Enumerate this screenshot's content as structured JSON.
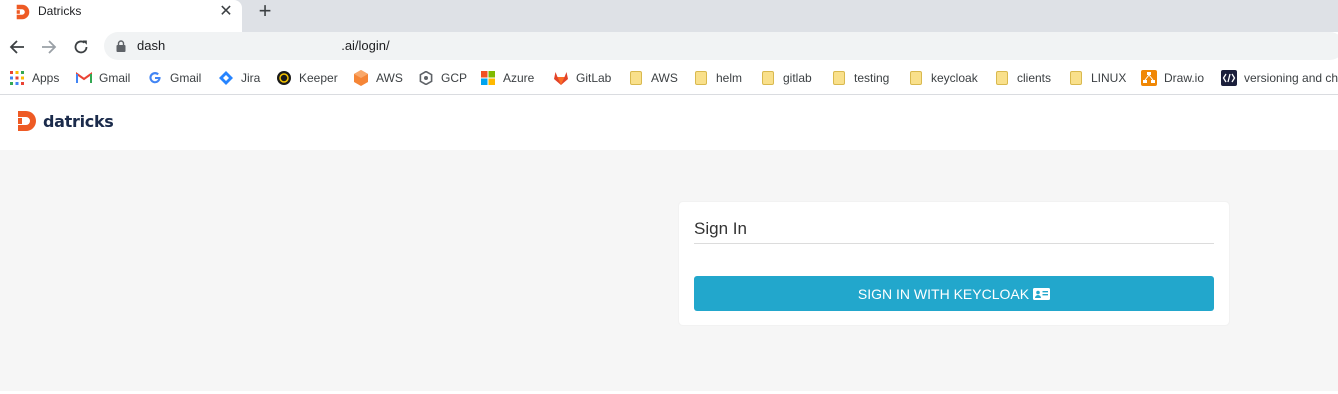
{
  "browser": {
    "tab": {
      "title": "Datricks",
      "close": "✕"
    },
    "new_tab": "+",
    "omnibox": {
      "url_start": "dash",
      "url_end": ".ai/login/"
    },
    "bookmarks": [
      {
        "label": "Apps",
        "icon": "apps-grid-icon"
      },
      {
        "label": "Gmail",
        "icon": "gmail-icon"
      },
      {
        "label": "Gmail",
        "icon": "google-icon"
      },
      {
        "label": "Jira",
        "icon": "jira-icon"
      },
      {
        "label": "Keeper",
        "icon": "keeper-icon"
      },
      {
        "label": "AWS",
        "icon": "aws-icon"
      },
      {
        "label": "GCP",
        "icon": "gcp-icon"
      },
      {
        "label": "Azure",
        "icon": "azure-icon"
      },
      {
        "label": "GitLab",
        "icon": "gitlab-icon"
      },
      {
        "label": "AWS",
        "icon": "folder-icon"
      },
      {
        "label": "helm",
        "icon": "folder-icon"
      },
      {
        "label": "gitlab",
        "icon": "folder-icon"
      },
      {
        "label": "testing",
        "icon": "folder-icon"
      },
      {
        "label": "keycloak",
        "icon": "folder-icon"
      },
      {
        "label": "clients",
        "icon": "folder-icon"
      },
      {
        "label": "LINUX",
        "icon": "folder-icon"
      },
      {
        "label": "Draw.io",
        "icon": "drawio-icon"
      },
      {
        "label": "versioning and ch",
        "icon": "versioning-icon"
      }
    ]
  },
  "site": {
    "brand": "datricks",
    "brand_color": "#ee5a24",
    "accent": "#22a7cc"
  },
  "login": {
    "title": "Sign In",
    "keycloak_button": "SIGN IN WITH KEYCLOAK",
    "keycloak_icon": "id-card-icon"
  }
}
